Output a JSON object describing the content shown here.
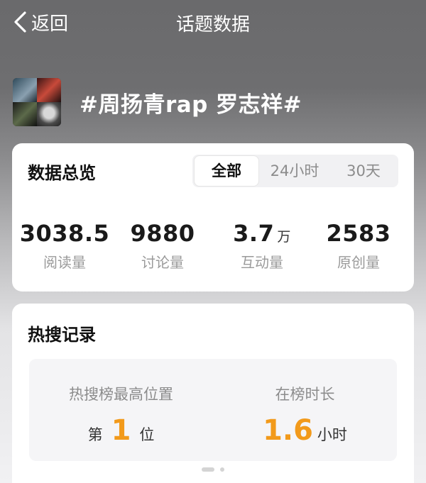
{
  "nav": {
    "back_label": "返回",
    "title": "话题数据"
  },
  "topic": {
    "title": "#周扬青rap 罗志祥#"
  },
  "overview": {
    "title": "数据总览",
    "tabs": [
      "全部",
      "24小时",
      "30天"
    ],
    "active_tab": "全部",
    "stats": [
      {
        "value": "3038.5",
        "unit": "",
        "label": "阅读量"
      },
      {
        "value": "9880",
        "unit": "",
        "label": "讨论量"
      },
      {
        "value": "3.7",
        "unit": "万",
        "label": "互动量"
      },
      {
        "value": "2583",
        "unit": "",
        "label": "原创量"
      }
    ]
  },
  "hot_search": {
    "title": "热搜记录",
    "peak": {
      "label": "热搜榜最高位置",
      "prefix": "第",
      "value": "1",
      "suffix": "位"
    },
    "duration": {
      "label": "在榜时长",
      "value": "1.6",
      "unit": "小时"
    }
  },
  "colors": {
    "accent": "#f29a1b",
    "card_bg": "#ffffff",
    "muted_text": "#9a9a9a"
  }
}
